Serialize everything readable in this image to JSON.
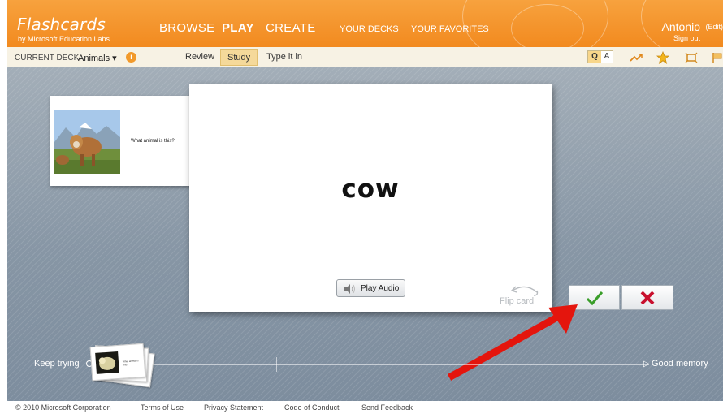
{
  "header": {
    "logo_title": "Flashcards",
    "logo_subtitle": "by Microsoft Education Labs",
    "nav": {
      "browse": "BROWSE",
      "play": "PLAY",
      "create": "CREATE",
      "your_decks": "YOUR DECKS",
      "your_favorites": "YOUR FAVORITES"
    },
    "user": {
      "name": "Antonio",
      "edit": "(Edit)",
      "sign_out": "Sign out"
    }
  },
  "toolbar": {
    "current_deck_label": "CURRENT DECK:",
    "current_deck_value": "Animals ▾",
    "info_icon": "i",
    "modes": {
      "review": "Review",
      "study": "Study",
      "type_it_in": "Type it in"
    },
    "qa": {
      "q": "Q",
      "a": "A"
    },
    "icons": [
      "trend-icon",
      "star-icon",
      "fullscreen-icon",
      "flag-icon"
    ]
  },
  "study": {
    "previous_card_caption": "What animal is this?",
    "card_word": "cow",
    "play_audio_label": "Play Audio",
    "flip_card_label": "Flip card",
    "progress": {
      "left_label": "Keep trying",
      "right_label": "Good memory"
    },
    "stack_caption": "What animal is this?"
  },
  "colors": {
    "header_orange": "#f28a1f",
    "check_green": "#3a9e2a",
    "x_red": "#c8102e",
    "arrow_red": "#e4150d"
  },
  "footer": {
    "copyright": "© 2010 Microsoft Corporation",
    "terms": "Terms of Use",
    "privacy": "Privacy Statement",
    "conduct": "Code of Conduct",
    "feedback": "Send Feedback"
  }
}
